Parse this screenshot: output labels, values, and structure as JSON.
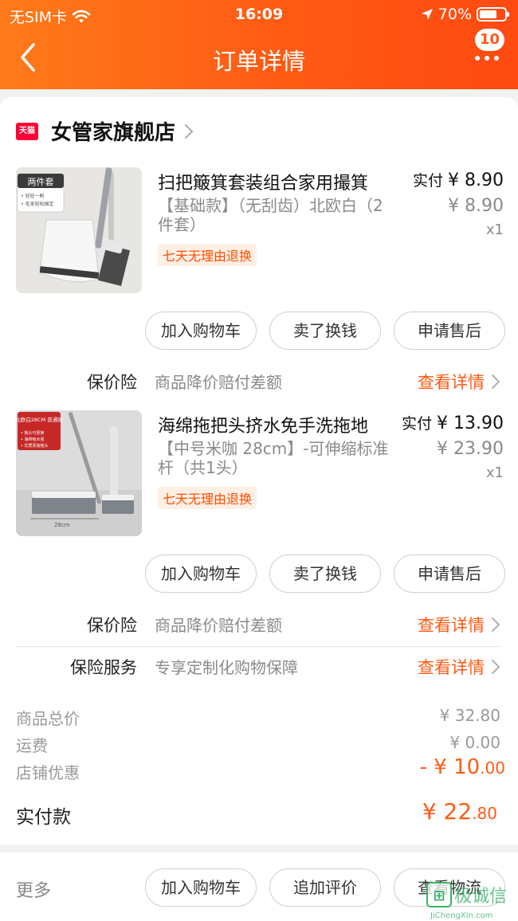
{
  "status_bar": {
    "carrier": "无SIM卡",
    "time": "16:09",
    "battery": "70%",
    "battery_level": 0.7
  },
  "header": {
    "title": "订单详情",
    "notification_count": "10"
  },
  "shop": {
    "badge_text": "天猫",
    "name": "女管家旗舰店"
  },
  "products": [
    {
      "title": "扫把簸箕套装组合家用撮箕",
      "sku": "【基础款】（无刮齿）北欧白（2件套）",
      "tag": "七天无理由退换",
      "paid_label": "实付",
      "paid_price": "¥ 8.90",
      "original_price": "¥ 8.90",
      "qty": "x1",
      "thumb_badge": "两件套",
      "thumb_lines": [
        "• 轻轻一刷",
        "• 毛发轻松搞定"
      ],
      "buttons": [
        "加入购物车",
        "卖了换钱",
        "申请售后"
      ],
      "insurance": {
        "label": "保价险",
        "desc": "商品降价赔付差额",
        "link": "查看详情"
      }
    },
    {
      "title": "海绵拖把头挤水免手洗拖地",
      "sku": "【中号米咖 28cm】-可伸缩标准杆（共1头）",
      "tag": "七天无理由退换",
      "paid_label": "实付",
      "paid_price": "¥ 13.90",
      "original_price": "¥ 23.90",
      "qty": "x1",
      "thumb_badge": "北欧白28CM 普通款",
      "thumb_lines": [
        "• 拖头可更换",
        "• 海绵吸水强",
        "• 优质原装拖头"
      ],
      "thumb_size": "28cm",
      "buttons": [
        "加入购物车",
        "卖了换钱",
        "申请售后"
      ],
      "insurance": {
        "label": "保价险",
        "desc": "商品降价赔付差额",
        "link": "查看详情"
      }
    }
  ],
  "insurance_service": {
    "label": "保险服务",
    "desc": "专享定制化购物保障",
    "link": "查看详情"
  },
  "summary": {
    "goods_total_label": "商品总价",
    "goods_total": "¥ 32.80",
    "shipping_label": "运费",
    "shipping": "¥ 0.00",
    "discount_label": "店铺优惠",
    "discount_main": "- ¥ 10",
    "discount_cents": ".00",
    "paid_label": "实付款",
    "paid_main": "¥ 22",
    "paid_cents": ".80"
  },
  "bottom_bar": {
    "more": "更多",
    "buttons": [
      "加入购物车",
      "追加评价",
      "查看物流"
    ]
  },
  "watermark": {
    "brand": "极诚信",
    "site": "JiChengXin.com"
  },
  "colors": {
    "accent": "#ff5a14",
    "tmall_red": "#ff0036"
  }
}
